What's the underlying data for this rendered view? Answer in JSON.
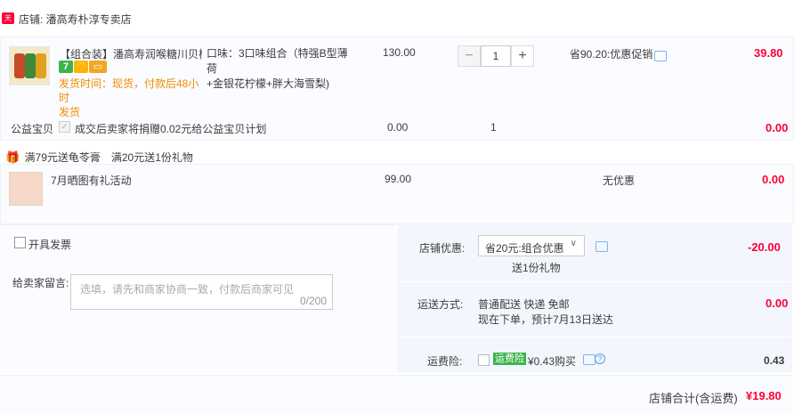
{
  "shop": {
    "badge": "天猫",
    "name": "店铺: 潘高寿朴淳专卖店"
  },
  "item": {
    "title": "【组合装】潘高寿润喉糖川贝枇...",
    "shipping_lines": [
      "发货时间：现货，付款后48小时",
      "发货"
    ],
    "taste_lines": [
      "口味：3口味组合（特强B型薄荷",
      "+金银花柠檬+胖大海雪梨)"
    ],
    "price": "130.00",
    "quantity": "1",
    "discount": "省90.20:优惠促销",
    "total": "39.80",
    "service_icons": [
      "seven-day-return-icon",
      "tmall-guarantee-icon",
      "card-payment-icon"
    ],
    "colors": {
      "seven": "#3bb54a",
      "guarantee": "#ffb400",
      "card": "#f5a623"
    }
  },
  "charity": {
    "label": "公益宝贝",
    "text": "成交后卖家将捐赠0.02元给公益宝贝计划",
    "price": "0.00",
    "qty": "1",
    "total": "0.00"
  },
  "promo": {
    "text": "满79元送龟苓膏　满20元送1份礼物"
  },
  "gift": {
    "title": "7月晒图有礼活动",
    "price": "99.00",
    "discount": "无优惠",
    "total": "0.00"
  },
  "invoice": {
    "label": "开具发票"
  },
  "message": {
    "label": "给卖家留言:",
    "placeholder": "选填，请先和商家协商一致，付款后商家可见",
    "counter": "0/200"
  },
  "shop_discount": {
    "label": "店铺优惠:",
    "selected": "省20元:组合优惠",
    "note": "送1份礼物",
    "amount": "-20.00"
  },
  "delivery": {
    "label": "运送方式:",
    "line1": "普通配送 快递 免邮",
    "line2": "现在下单，预计7月13日送达",
    "amount": "0.00"
  },
  "insurance": {
    "label": "运费险:",
    "badge": "运费险",
    "text": "¥0.43购买",
    "amount": "0.43"
  },
  "footer": {
    "label": "店铺合计(含运费)",
    "total": "¥19.80"
  }
}
